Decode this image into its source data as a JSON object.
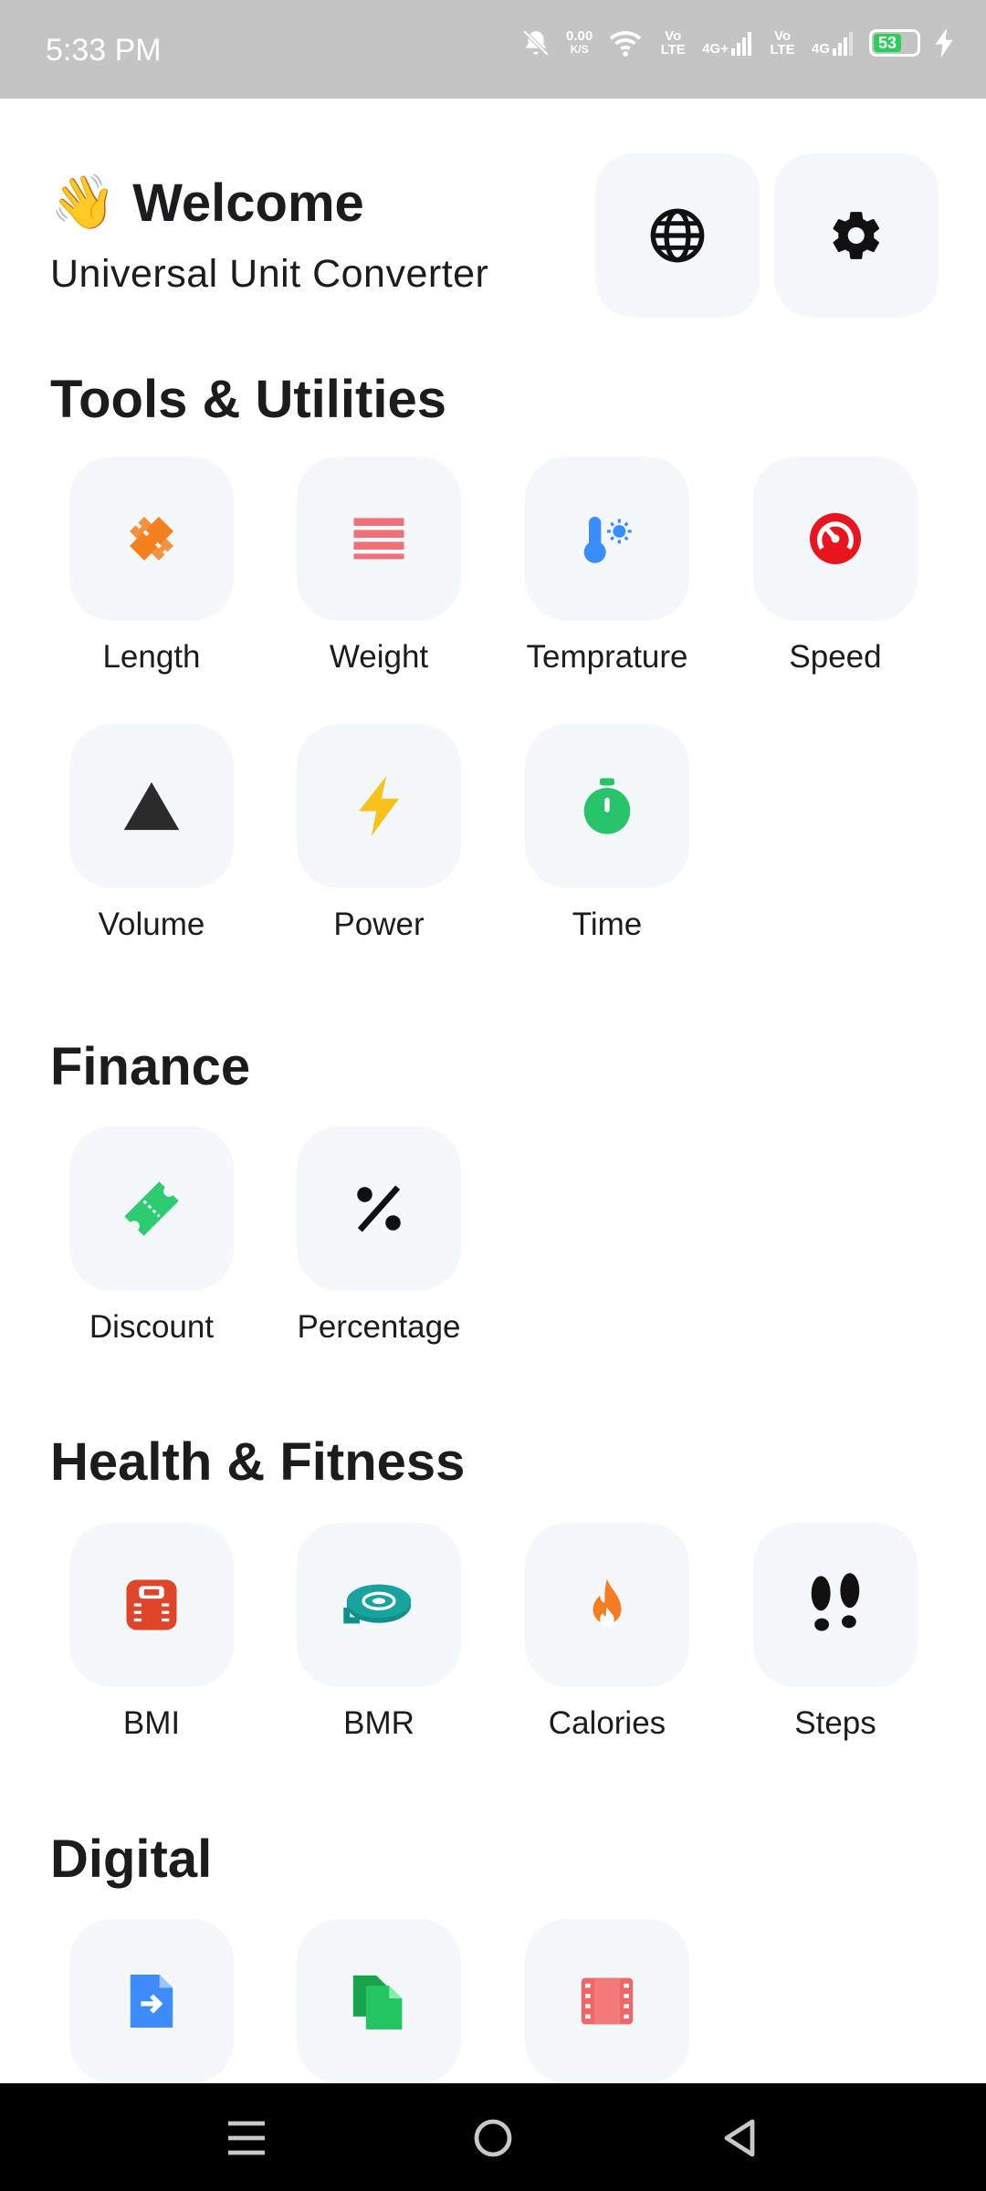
{
  "status": {
    "time": "5:33 PM",
    "net_speed_value": "0.00",
    "net_speed_unit": "K/S",
    "volte1": "Vo LTE",
    "sig1": "4G+",
    "volte2": "Vo LTE",
    "sig2": "4G",
    "battery": "53"
  },
  "header": {
    "wave": "👋",
    "title": "Welcome",
    "subtitle": "Universal Unit Converter",
    "language_icon": "globe-icon",
    "settings_icon": "gear-icon"
  },
  "sections": {
    "tools": {
      "title": "Tools & Utilities",
      "items": [
        {
          "label": "Length",
          "icon": "ruler-icon",
          "color": "#f5801f"
        },
        {
          "label": "Weight",
          "icon": "weight-lines-icon",
          "color": "#f07077"
        },
        {
          "label": "Temprature",
          "icon": "thermometer-icon",
          "color": "#3a8dff"
        },
        {
          "label": "Speed",
          "icon": "speedometer-icon",
          "color": "#e8151e"
        },
        {
          "label": "Volume",
          "icon": "triangle-icon",
          "color": "#2b2b2b"
        },
        {
          "label": "Power",
          "icon": "lightning-icon",
          "color": "#f7c21a"
        },
        {
          "label": "Time",
          "icon": "stopwatch-icon",
          "color": "#27c46b"
        }
      ]
    },
    "finance": {
      "title": "Finance",
      "items": [
        {
          "label": "Discount",
          "icon": "ticket-icon",
          "color": "#2ecc71"
        },
        {
          "label": "Percentage",
          "icon": "percent-icon",
          "color": "#111111"
        }
      ]
    },
    "health": {
      "title": "Health & Fitness",
      "items": [
        {
          "label": "BMI",
          "icon": "scale-icon",
          "color": "#e0452a"
        },
        {
          "label": "BMR",
          "icon": "tape-measure-icon",
          "color": "#138f8a"
        },
        {
          "label": "Calories",
          "icon": "flame-icon",
          "color": "#f57c22"
        },
        {
          "label": "Steps",
          "icon": "footprints-icon",
          "color": "#111111"
        }
      ]
    },
    "digital": {
      "title": "Digital",
      "items": [
        {
          "label": "",
          "icon": "file-arrow-icon",
          "color": "#3d8bfd"
        },
        {
          "label": "",
          "icon": "files-icon",
          "color": "#22c55e"
        },
        {
          "label": "",
          "icon": "film-icon",
          "color": "#f06565"
        }
      ]
    }
  },
  "navbar": {
    "menu_icon": "menu-icon",
    "home_icon": "home-circle-icon",
    "back_icon": "back-triangle-icon"
  }
}
